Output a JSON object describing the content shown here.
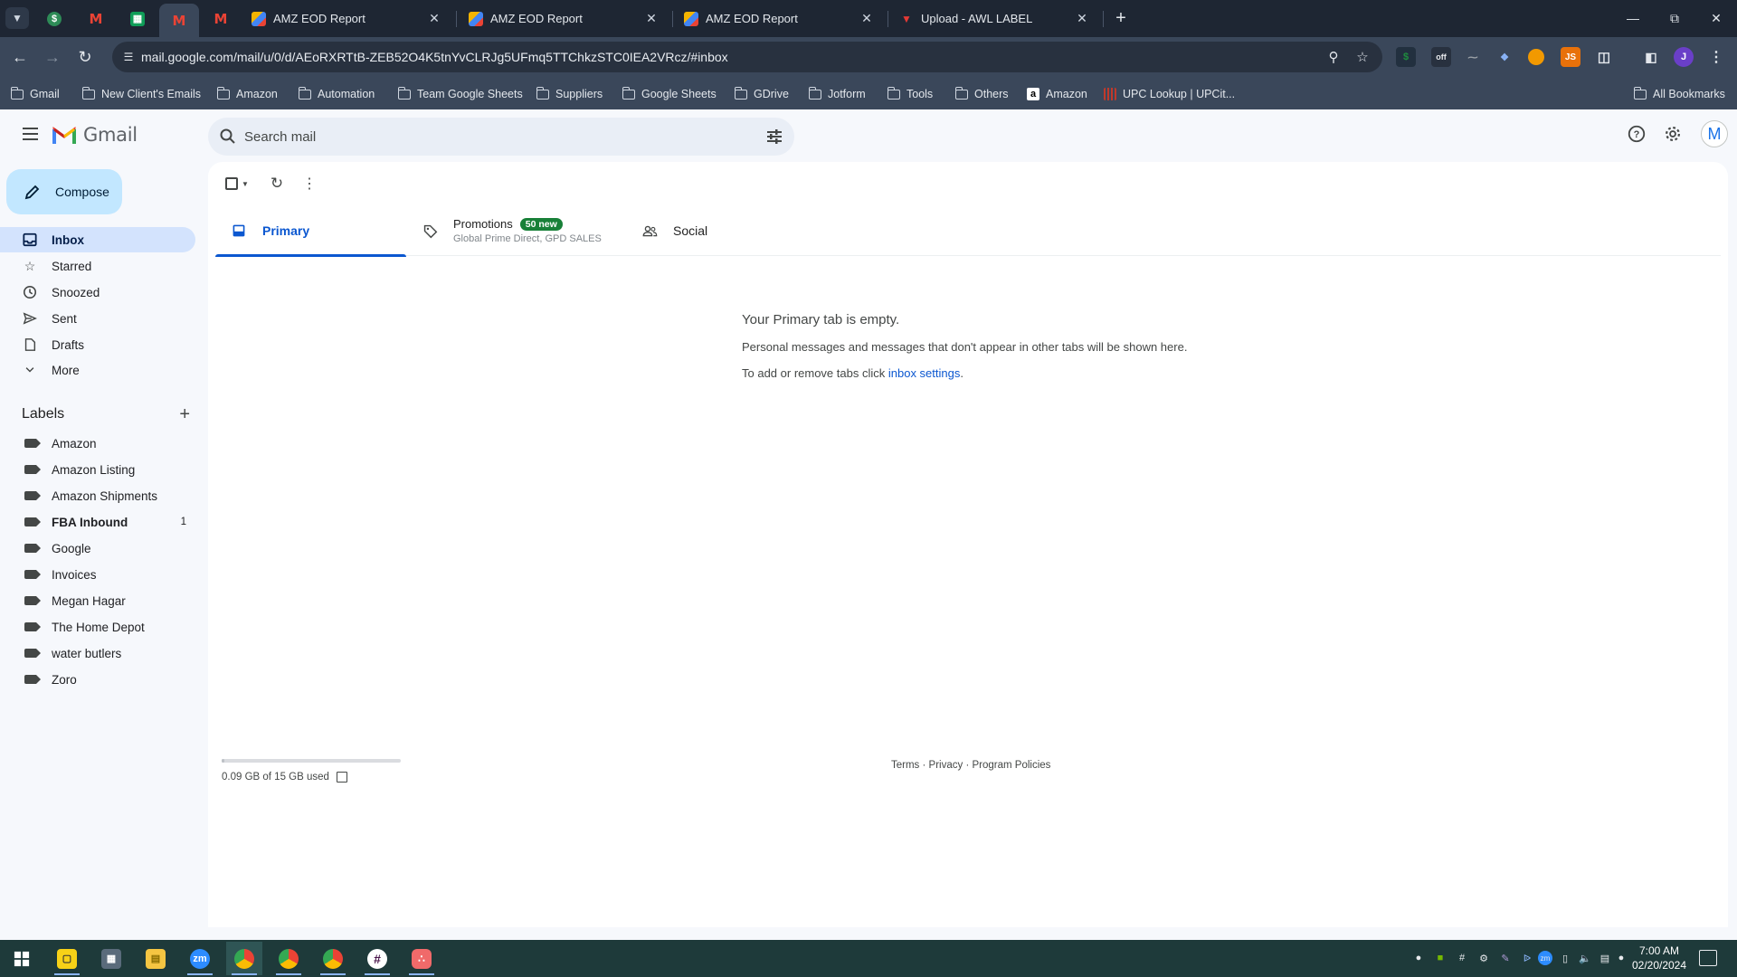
{
  "browser": {
    "tabs": [
      {
        "title": "AMZ EOD Report",
        "favicon": "amz-eod-icon"
      },
      {
        "title": "AMZ EOD Report",
        "favicon": "amz-eod-icon"
      },
      {
        "title": "AMZ EOD Report",
        "favicon": "amz-eod-icon"
      },
      {
        "title": "Upload - AWL LABEL",
        "favicon": "awl-label-icon"
      }
    ],
    "pinned_tabs": [
      "green-circle-icon",
      "gmail-icon",
      "sheets-icon",
      "gmail-icon",
      "gmail-icon"
    ],
    "url": "mail.google.com/mail/u/0/d/AEoRXRTtB-ZEB52O4K5tnYvCLRJg5UFmq5TTChkzSTC0IEA2VRcz/#inbox",
    "profile_initial": "J",
    "bookmarks": [
      {
        "label": "Gmail",
        "icon": "folder-icon"
      },
      {
        "label": "New Client's Emails",
        "icon": "folder-icon"
      },
      {
        "label": "Amazon",
        "icon": "folder-icon"
      },
      {
        "label": "Automation",
        "icon": "folder-icon"
      },
      {
        "label": "Team Google Sheets",
        "icon": "folder-icon"
      },
      {
        "label": "Suppliers",
        "icon": "folder-icon"
      },
      {
        "label": "Google Sheets",
        "icon": "folder-icon"
      },
      {
        "label": "GDrive",
        "icon": "folder-icon"
      },
      {
        "label": "Jotform",
        "icon": "folder-icon"
      },
      {
        "label": "Tools",
        "icon": "folder-icon"
      },
      {
        "label": "Others",
        "icon": "folder-icon"
      },
      {
        "label": "Amazon",
        "icon": "amazon-icon"
      },
      {
        "label": "UPC Lookup | UPCit...",
        "icon": "barcode-icon"
      }
    ],
    "all_bookmarks": "All Bookmarks"
  },
  "gmail": {
    "app_name": "Gmail",
    "search_placeholder": "Search mail",
    "compose_label": "Compose",
    "account_initial": "M",
    "nav": [
      {
        "label": "Inbox",
        "icon": "inbox-icon",
        "active": true
      },
      {
        "label": "Starred",
        "icon": "star-icon"
      },
      {
        "label": "Snoozed",
        "icon": "clock-icon"
      },
      {
        "label": "Sent",
        "icon": "send-icon"
      },
      {
        "label": "Drafts",
        "icon": "draft-icon"
      },
      {
        "label": "More",
        "icon": "chevron-down-icon"
      }
    ],
    "labels_title": "Labels",
    "labels": [
      {
        "label": "Amazon"
      },
      {
        "label": "Amazon Listing"
      },
      {
        "label": "Amazon Shipments"
      },
      {
        "label": "FBA Inbound",
        "count": "1",
        "bold": true
      },
      {
        "label": "Google"
      },
      {
        "label": "Invoices"
      },
      {
        "label": "Megan Hagar"
      },
      {
        "label": "The Home Depot"
      },
      {
        "label": "water butlers"
      },
      {
        "label": "Zoro"
      }
    ],
    "inbox_tabs": [
      {
        "label": "Primary",
        "icon": "inbox-tab-icon",
        "active": true
      },
      {
        "label": "Promotions",
        "icon": "tag-icon",
        "badge": "50 new",
        "sub": "Global Prime Direct, GPD SALES"
      },
      {
        "label": "Social",
        "icon": "people-icon"
      }
    ],
    "empty_state": {
      "title": "Your Primary tab is empty.",
      "line1": "Personal messages and messages that don't appear in other tabs will be shown here.",
      "line2_prefix": "To add or remove tabs click ",
      "line2_link": "inbox settings",
      "line2_suffix": "."
    },
    "storage": {
      "text": "0.09 GB of 15 GB used",
      "used_fraction": 0.006
    },
    "footer": {
      "terms": "Terms",
      "privacy": "Privacy",
      "policies": "Program Policies",
      "sep": " · "
    },
    "colors": {
      "accent": "#0b57d0",
      "compose_bg": "#c2e7ff",
      "active_nav": "#d3e3fd",
      "badge": "#188038"
    }
  },
  "taskbar": {
    "apps": [
      "windows-start-icon",
      "sticky-notes-icon",
      "calculator-icon",
      "file-explorer-icon",
      "zoom-icon",
      "chrome-icon",
      "chrome-icon",
      "chrome-icon",
      "slack-icon",
      "asana-icon"
    ],
    "time": "7:00 AM",
    "date": "02/20/2024"
  }
}
